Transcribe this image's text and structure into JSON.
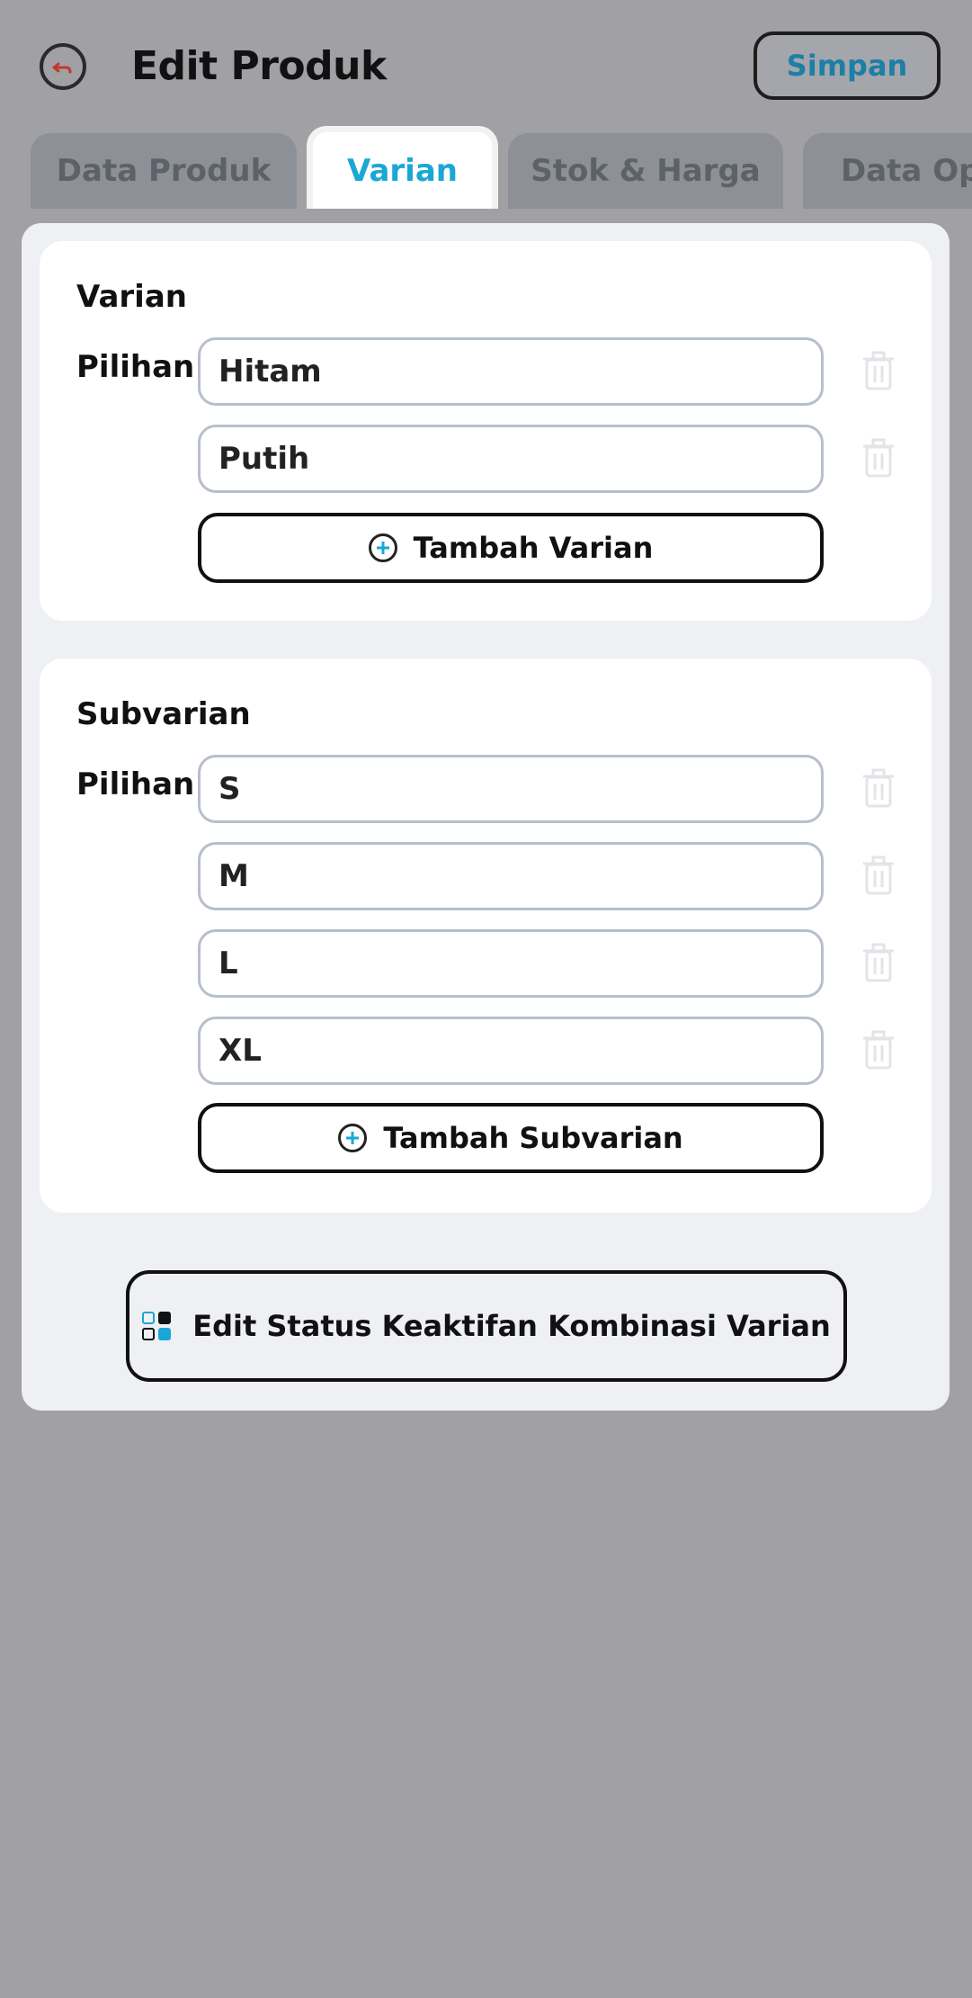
{
  "header": {
    "title": "Edit Produk",
    "save_label": "Simpan"
  },
  "tabs": [
    {
      "label": "Data Produk",
      "active": false
    },
    {
      "label": "Varian",
      "active": true
    },
    {
      "label": "Stok & Harga",
      "active": false
    },
    {
      "label": "Data Ops",
      "active": false
    }
  ],
  "varian": {
    "title": "Varian",
    "row_label": "Pilihan",
    "options": [
      "Hitam",
      "Putih"
    ],
    "add_label": "Tambah Varian"
  },
  "subvarian": {
    "title": "Subvarian",
    "row_label": "Pilihan",
    "options": [
      "S",
      "M",
      "L",
      "XL"
    ],
    "add_label": "Tambah Subvarian"
  },
  "combo_button_label": "Edit Status Keaktifan Kombinasi Varian",
  "colors": {
    "accent": "#1aa7d6",
    "overlay": "#a0a0a5",
    "back_arrow": "#c0392b"
  },
  "icons": {
    "back": "back-arrow-circle-icon",
    "trash": "trash-icon",
    "add": "plus-circle-icon",
    "combo": "grid-icon"
  }
}
